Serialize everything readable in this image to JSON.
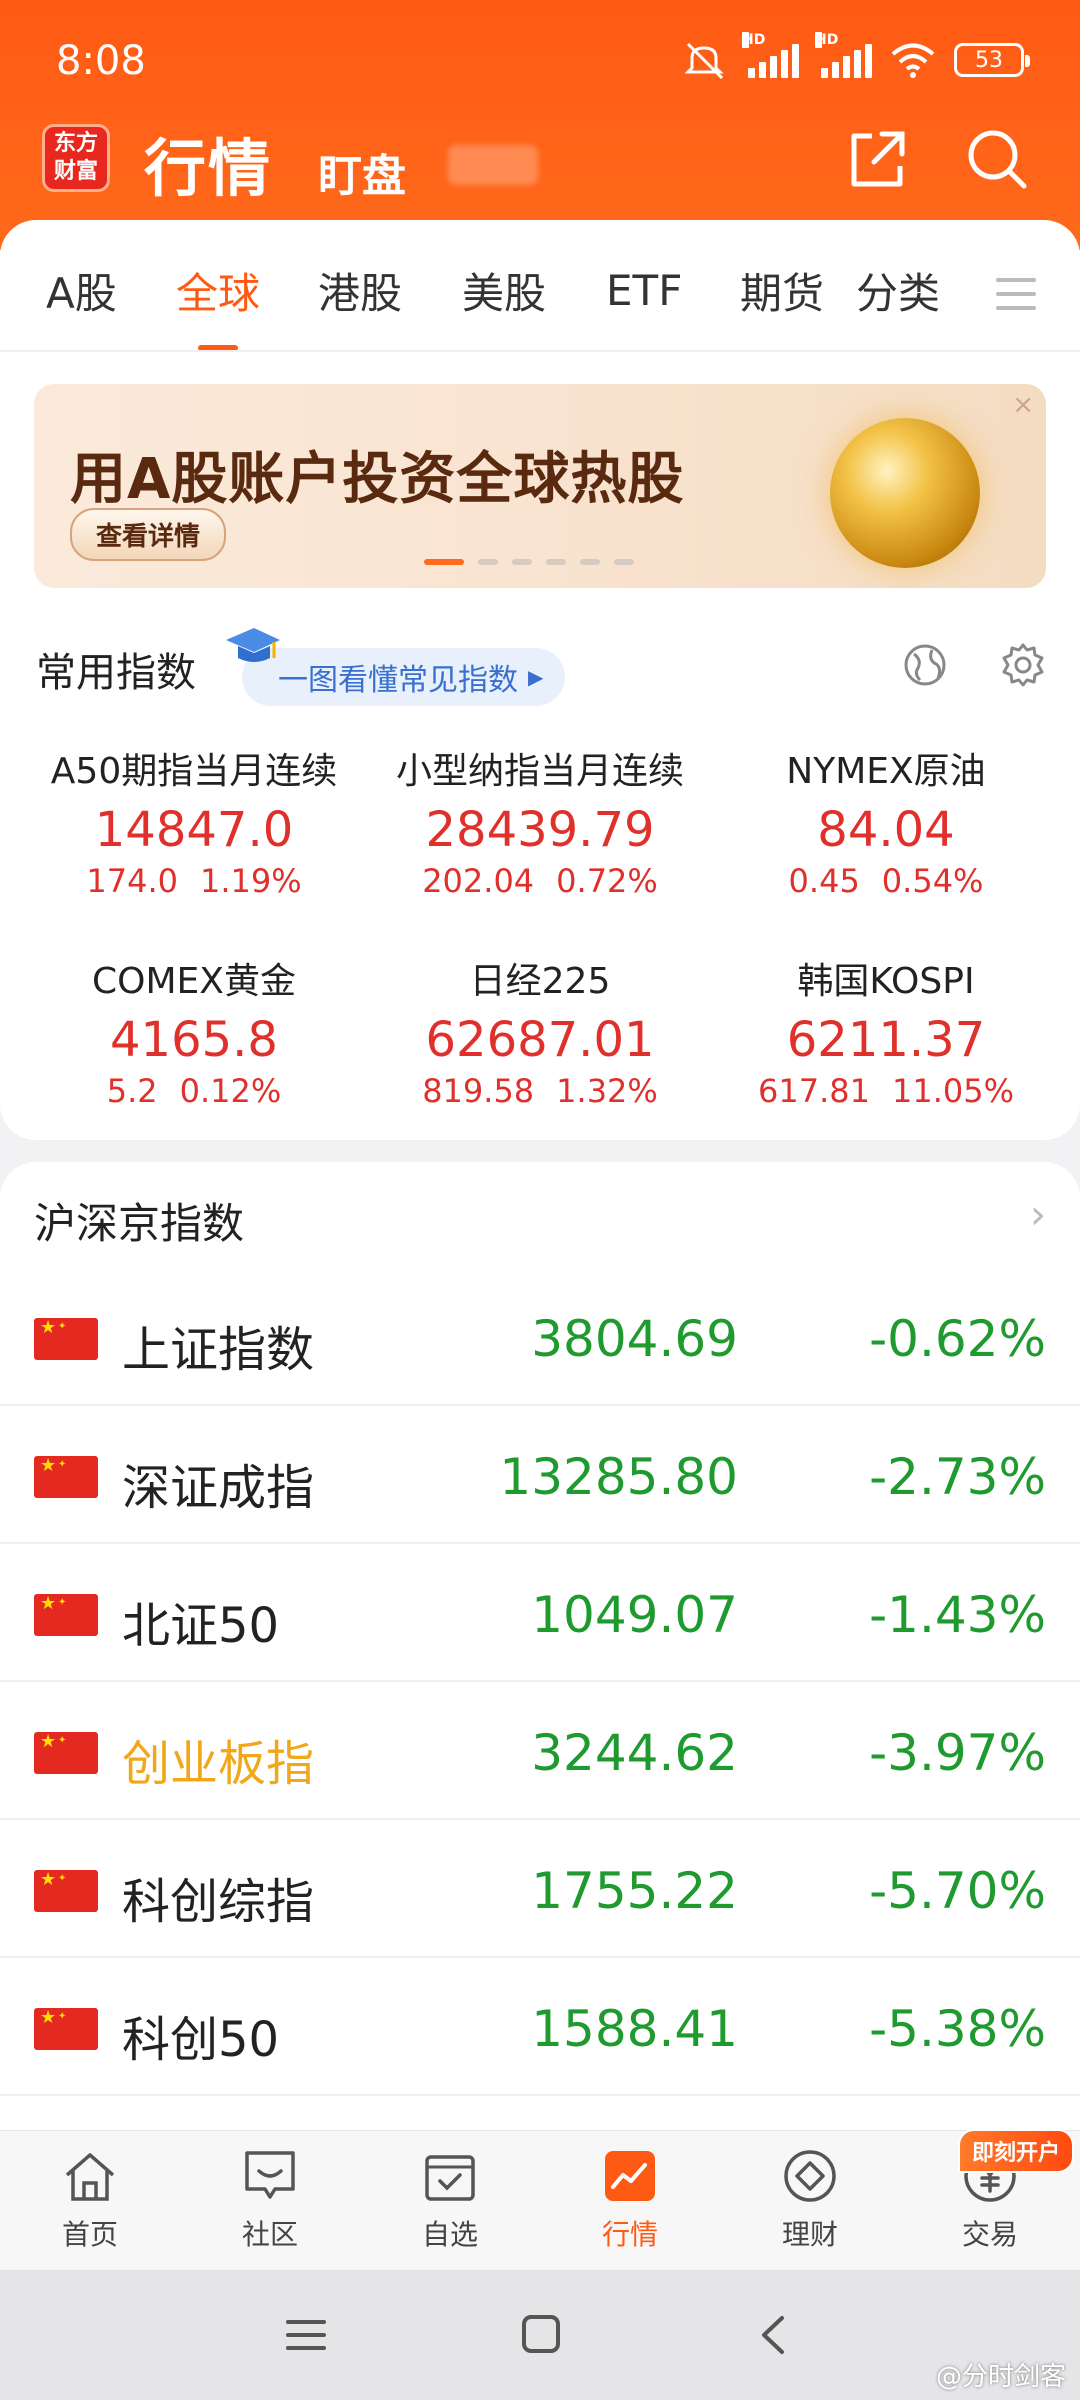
{
  "status_bar": {
    "time": "8:08",
    "battery": "53",
    "hd": "HD"
  },
  "header": {
    "logo_line1": "东方",
    "logo_line2": "财富",
    "title": "行情",
    "watch_label": "盯盘"
  },
  "tabs": [
    "A股",
    "全球",
    "港股",
    "美股",
    "ETF",
    "期货",
    "分类"
  ],
  "active_tab": "全球",
  "banner": {
    "title": "用A股账户投资全球热股",
    "button": "查看详情",
    "close": "×"
  },
  "common_indices": {
    "title": "常用指数",
    "pill": "一图看懂常见指数",
    "items": [
      {
        "name": "A50期指当月连续",
        "price": "14847.0",
        "change": "174.0",
        "pct": "1.19%"
      },
      {
        "name": "小型纳指当月连续",
        "price": "28439.79",
        "change": "202.04",
        "pct": "0.72%"
      },
      {
        "name": "NYMEX原油",
        "price": "84.04",
        "change": "0.45",
        "pct": "0.54%"
      },
      {
        "name": "COMEX黄金",
        "price": "4165.8",
        "change": "5.2",
        "pct": "0.12%"
      },
      {
        "name": "日经225",
        "price": "62687.01",
        "change": "819.58",
        "pct": "1.32%"
      },
      {
        "name": "韩国KOSPI",
        "price": "6211.37",
        "change": "617.81",
        "pct": "11.05%"
      }
    ]
  },
  "domestic": {
    "title": "沪深京指数",
    "rows": [
      {
        "name": "上证指数",
        "price": "3804.69",
        "pct": "-0.62%"
      },
      {
        "name": "深证成指",
        "price": "13285.80",
        "pct": "-2.73%"
      },
      {
        "name": "北证50",
        "price": "1049.07",
        "pct": "-1.43%"
      },
      {
        "name": "创业板指",
        "price": "3244.62",
        "pct": "-3.97%"
      },
      {
        "name": "科创综指",
        "price": "1755.22",
        "pct": "-5.70%"
      },
      {
        "name": "科创50",
        "price": "1588.41",
        "pct": "-5.38%"
      }
    ]
  },
  "bottom_nav": {
    "items": [
      "首页",
      "社区",
      "自选",
      "行情",
      "理财",
      "交易"
    ],
    "active": "行情",
    "open_badge": "即刻开户"
  },
  "watermark": "@分时剑客",
  "colors": {
    "brand": "#ff5a14",
    "up": "#e0302b",
    "down": "#1e9a2f",
    "highlight_name": "#f0a81a"
  }
}
